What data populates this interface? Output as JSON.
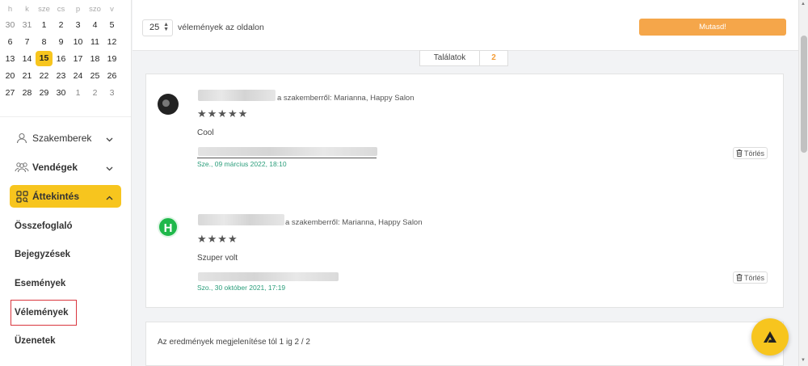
{
  "calendar": {
    "weekdays": [
      "h",
      "k",
      "sze",
      "cs",
      "p",
      "szo",
      "v"
    ],
    "weeks": [
      [
        "30",
        "31",
        "1",
        "2",
        "3",
        "4",
        "5"
      ],
      [
        "6",
        "7",
        "8",
        "9",
        "10",
        "11",
        "12"
      ],
      [
        "13",
        "14",
        "15",
        "16",
        "17",
        "18",
        "19"
      ],
      [
        "20",
        "21",
        "22",
        "23",
        "24",
        "25",
        "26"
      ],
      [
        "27",
        "28",
        "29",
        "30",
        "1",
        "2",
        "3"
      ]
    ],
    "today": "15"
  },
  "sidebar": {
    "specialists": "Szakemberek",
    "guests": "Vendégek",
    "overview": "Áttekintés",
    "sub_items": [
      "Összefoglaló",
      "Bejegyzések",
      "Események",
      "Vélemények",
      "Üzenetek"
    ],
    "selected_sub_item": "Vélemények"
  },
  "toolbar": {
    "per_page_value": "25",
    "per_page_label": "vélemények az oldalon",
    "show_button": "Mutasd!"
  },
  "results": {
    "label": "Találatok",
    "count": "2"
  },
  "reviews": [
    {
      "avatar_icon": "user-photo-icon",
      "specialist_text": "a szakemberről: Marianna, Happy Salon",
      "rating": 5,
      "stars": "★★★★★",
      "comment": "Cool",
      "date": "Sze., 09 március 2022, 18:10",
      "delete_label": "Törlés"
    },
    {
      "avatar_icon": "h-logo-icon",
      "avatar_letter": "H",
      "specialist_text": "a szakemberről: Marianna, Happy Salon",
      "rating": 4,
      "stars": "★★★★",
      "comment": "Szuper volt",
      "date": "Szo., 30 október 2021, 17:19",
      "delete_label": "Törlés"
    }
  ],
  "footer": {
    "pagination_text": "Az eredmények megjelenítése tól 1 ig 2 / 2"
  },
  "colors": {
    "accent_yellow": "#f7c51e",
    "button_orange": "#f5a64a",
    "count_orange": "#f39c35",
    "date_green": "#2a9d7a",
    "highlight_red": "#d9363e"
  }
}
